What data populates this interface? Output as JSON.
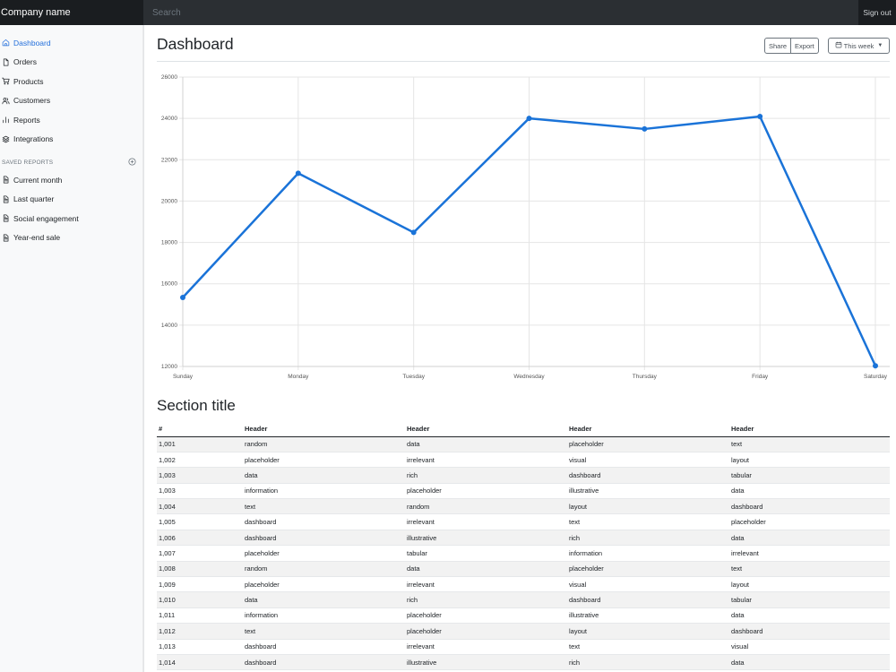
{
  "navbar": {
    "brand": "Company name",
    "search_placeholder": "Search",
    "signout_label": "Sign out"
  },
  "sidebar": {
    "items": [
      {
        "label": "Dashboard",
        "icon": "home-icon",
        "active": true
      },
      {
        "label": "Orders",
        "icon": "file-icon",
        "active": false
      },
      {
        "label": "Products",
        "icon": "cart-icon",
        "active": false
      },
      {
        "label": "Customers",
        "icon": "users-icon",
        "active": false
      },
      {
        "label": "Reports",
        "icon": "bar-chart-icon",
        "active": false
      },
      {
        "label": "Integrations",
        "icon": "layers-icon",
        "active": false
      }
    ],
    "saved_heading": "SAVED REPORTS",
    "saved_items": [
      {
        "label": "Current month",
        "icon": "file-text-icon"
      },
      {
        "label": "Last quarter",
        "icon": "file-text-icon"
      },
      {
        "label": "Social engagement",
        "icon": "file-text-icon"
      },
      {
        "label": "Year-end sale",
        "icon": "file-text-icon"
      }
    ]
  },
  "header": {
    "title": "Dashboard",
    "share_label": "Share",
    "export_label": "Export",
    "period_label": "This week"
  },
  "chart_data": {
    "type": "line",
    "categories": [
      "Sunday",
      "Monday",
      "Tuesday",
      "Wednesday",
      "Thursday",
      "Friday",
      "Saturday"
    ],
    "values": [
      15339,
      21345,
      18483,
      24003,
      23489,
      24092,
      12034
    ],
    "ylim": [
      12000,
      26000
    ],
    "yticks": [
      12000,
      14000,
      16000,
      18000,
      20000,
      22000,
      24000,
      26000
    ],
    "grid": true,
    "color": "#1a73d8"
  },
  "section": {
    "title": "Section title"
  },
  "table": {
    "headers": [
      "#",
      "Header",
      "Header",
      "Header",
      "Header"
    ],
    "rows": [
      [
        "1,001",
        "random",
        "data",
        "placeholder",
        "text"
      ],
      [
        "1,002",
        "placeholder",
        "irrelevant",
        "visual",
        "layout"
      ],
      [
        "1,003",
        "data",
        "rich",
        "dashboard",
        "tabular"
      ],
      [
        "1,003",
        "information",
        "placeholder",
        "illustrative",
        "data"
      ],
      [
        "1,004",
        "text",
        "random",
        "layout",
        "dashboard"
      ],
      [
        "1,005",
        "dashboard",
        "irrelevant",
        "text",
        "placeholder"
      ],
      [
        "1,006",
        "dashboard",
        "illustrative",
        "rich",
        "data"
      ],
      [
        "1,007",
        "placeholder",
        "tabular",
        "information",
        "irrelevant"
      ],
      [
        "1,008",
        "random",
        "data",
        "placeholder",
        "text"
      ],
      [
        "1,009",
        "placeholder",
        "irrelevant",
        "visual",
        "layout"
      ],
      [
        "1,010",
        "data",
        "rich",
        "dashboard",
        "tabular"
      ],
      [
        "1,011",
        "information",
        "placeholder",
        "illustrative",
        "data"
      ],
      [
        "1,012",
        "text",
        "placeholder",
        "layout",
        "dashboard"
      ],
      [
        "1,013",
        "dashboard",
        "irrelevant",
        "text",
        "visual"
      ],
      [
        "1,014",
        "dashboard",
        "illustrative",
        "rich",
        "data"
      ]
    ]
  }
}
